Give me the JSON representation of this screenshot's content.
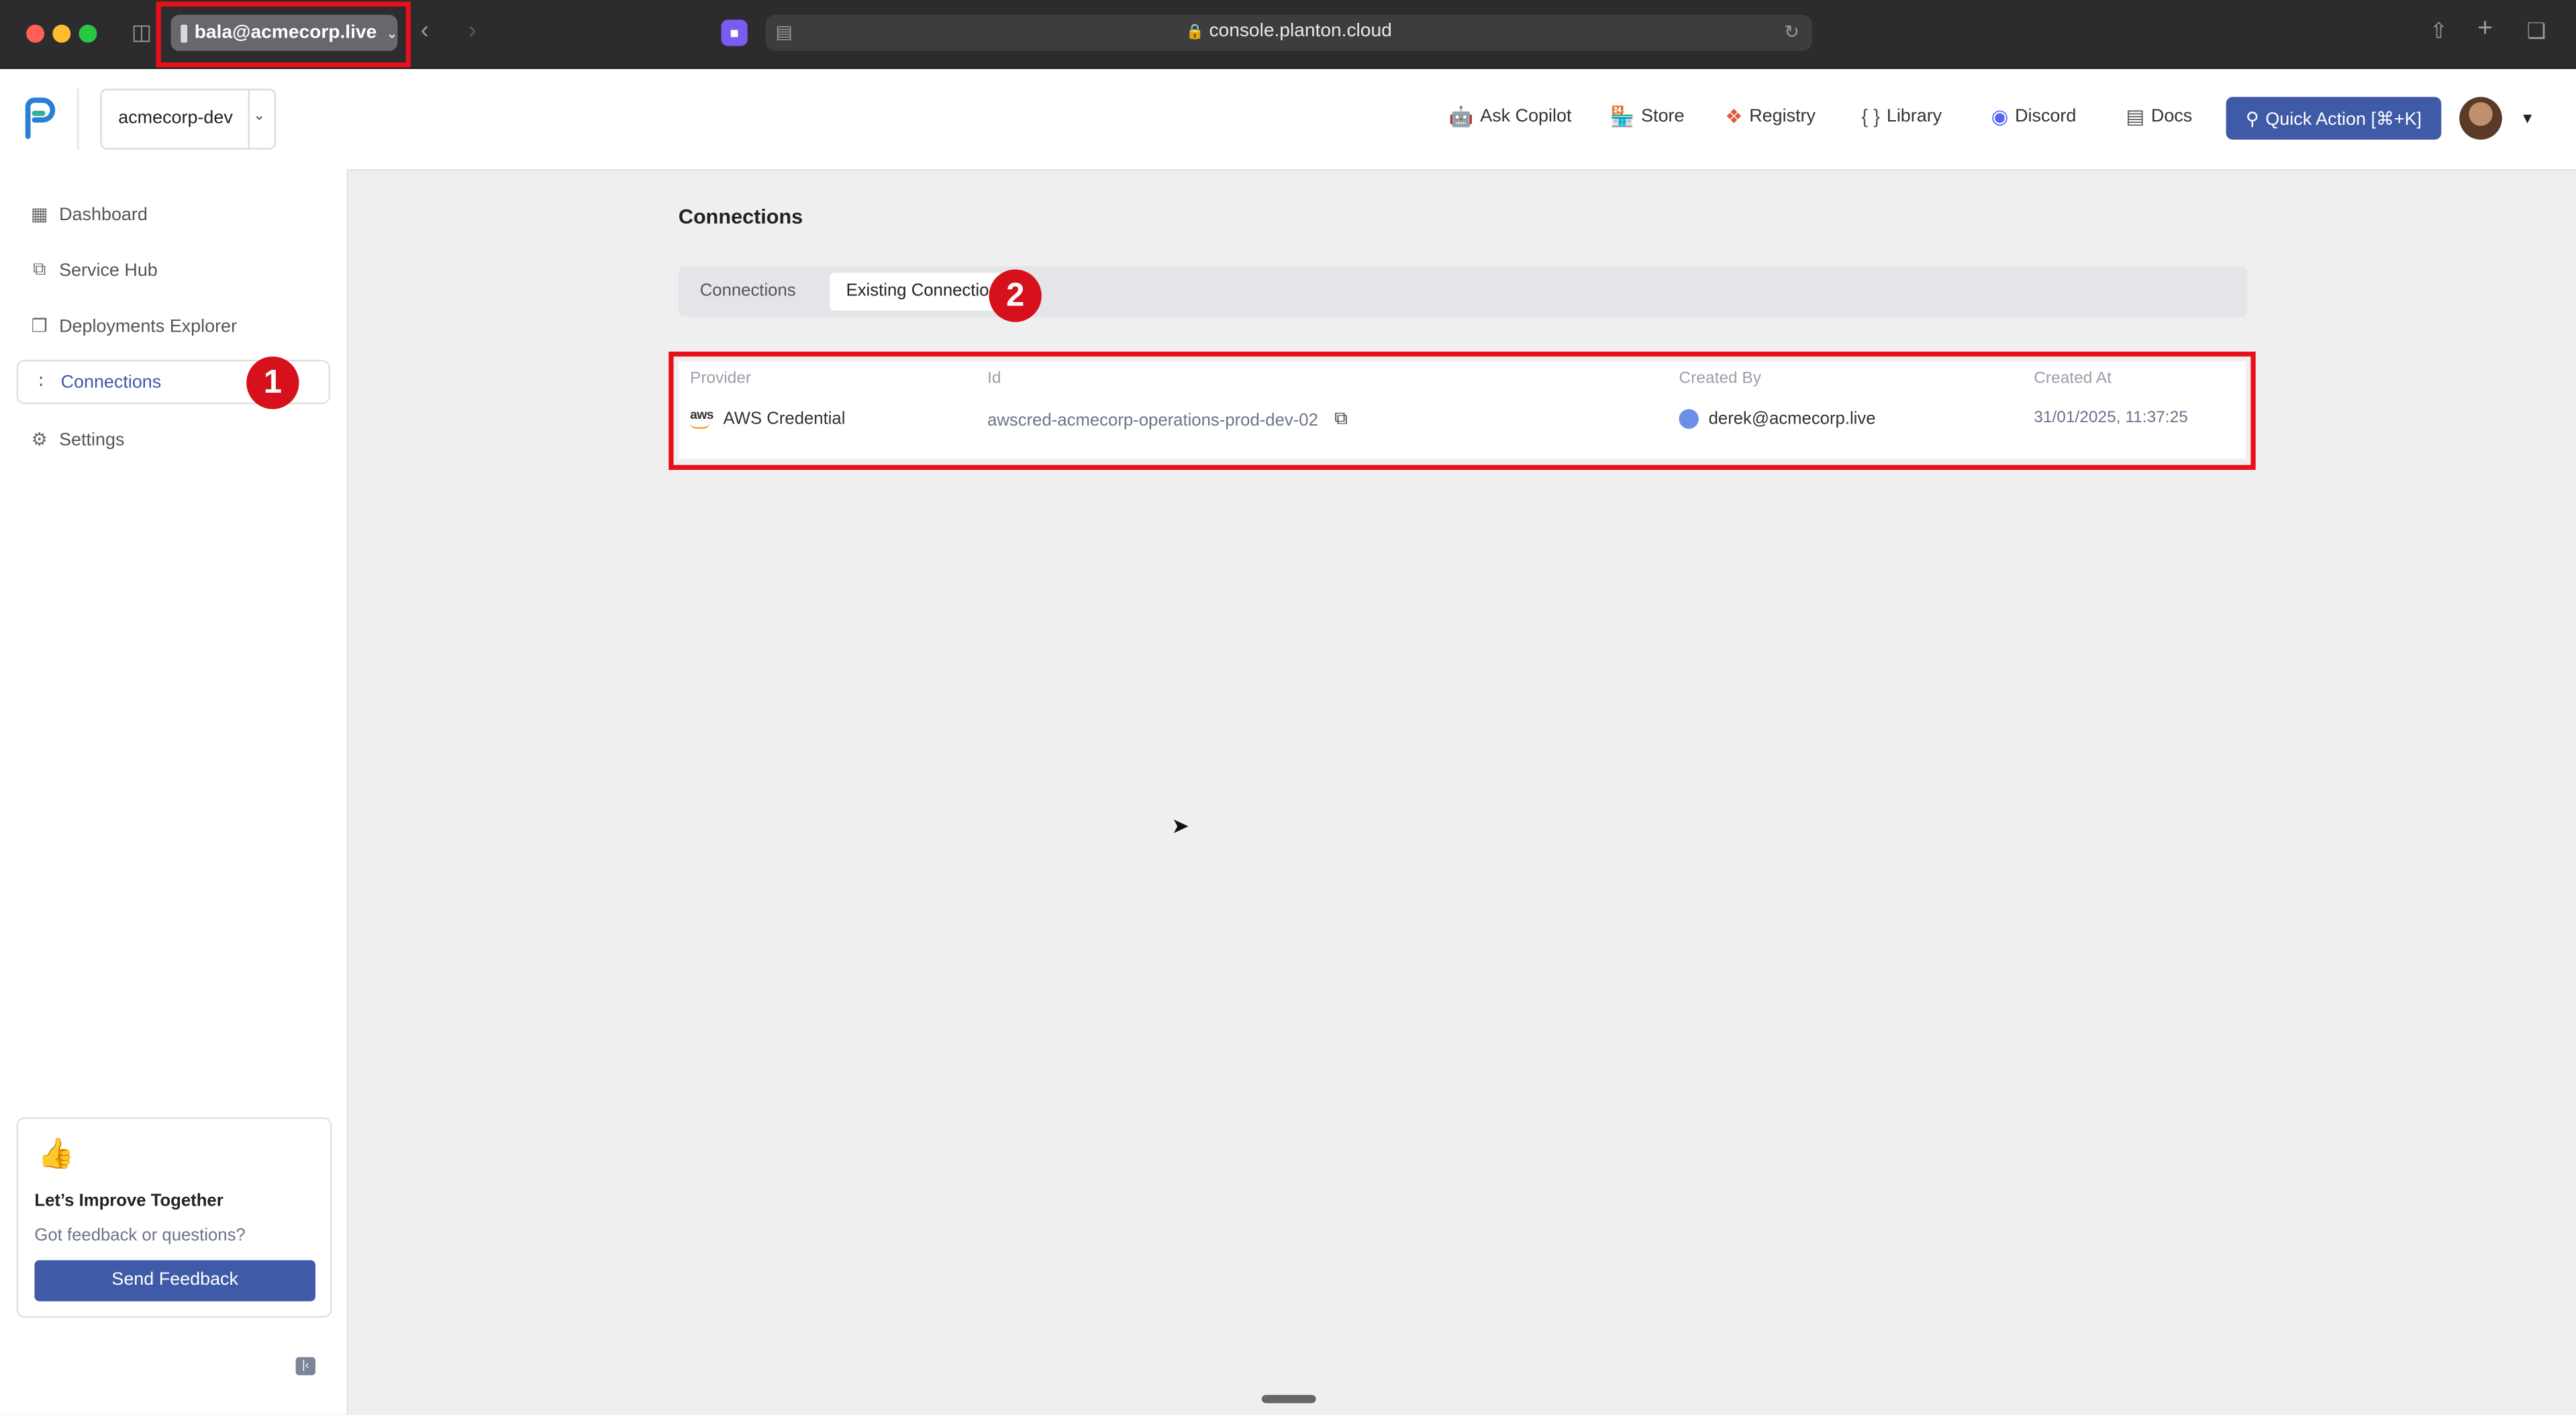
{
  "browser": {
    "profile_label": "bala@acmecorp.live",
    "url": "console.planton.cloud"
  },
  "header": {
    "org_name": "acmecorp-dev",
    "nav": [
      {
        "label": "Ask Copilot",
        "icon": "robot-icon"
      },
      {
        "label": "Store",
        "icon": "store-icon"
      },
      {
        "label": "Registry",
        "icon": "registry-icon"
      },
      {
        "label": "Library",
        "icon": "braces-icon"
      },
      {
        "label": "Discord",
        "icon": "discord-icon"
      },
      {
        "label": "Docs",
        "icon": "docs-icon"
      }
    ],
    "quick_action_label": "Quick Action [⌘+K]"
  },
  "sidebar": {
    "items": [
      {
        "label": "Dashboard",
        "icon": "dashboard-icon"
      },
      {
        "label": "Service Hub",
        "icon": "service-hub-icon"
      },
      {
        "label": "Deployments Explorer",
        "icon": "deployments-icon"
      },
      {
        "label": "Connections",
        "icon": "connections-icon",
        "active": true
      },
      {
        "label": "Settings",
        "icon": "settings-icon"
      }
    ],
    "feedback": {
      "title": "Let’s Improve Together",
      "subtitle": "Got feedback or questions?",
      "button_label": "Send Feedback"
    }
  },
  "main": {
    "title": "Connections",
    "tabs": [
      {
        "label": "Connections",
        "active": false
      },
      {
        "label": "Existing Connectio",
        "active": true
      }
    ],
    "table": {
      "columns": [
        "Provider",
        "Id",
        "Created By",
        "Created At"
      ],
      "rows": [
        {
          "provider": "AWS Credential",
          "id": "awscred-acmecorp-operations-prod-dev-02",
          "created_by": "derek@acmecorp.live",
          "created_at": "31/01/2025, 11:37:25"
        }
      ]
    }
  },
  "annotations": {
    "step1": "1",
    "step2": "2"
  },
  "colors": {
    "accent": "#3f5aa6",
    "highlight": "#e8101a",
    "badge": "#d6111c"
  }
}
